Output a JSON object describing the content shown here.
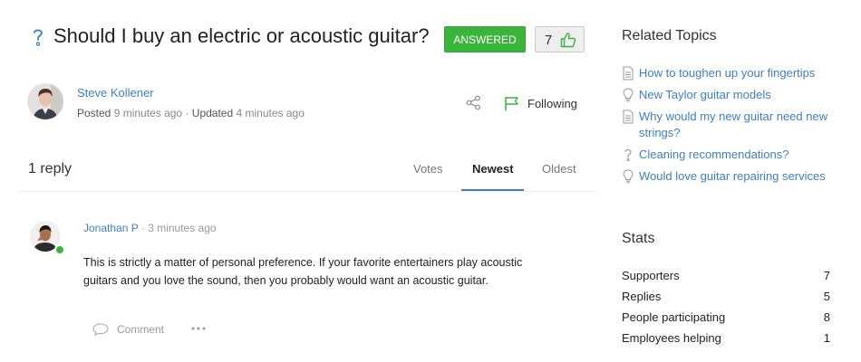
{
  "question": {
    "title": "Should I buy an electric or acoustic guitar?",
    "status_badge": "ANSWERED",
    "vote_count": "7",
    "icons": {
      "type": "question-mark-icon",
      "vote": "thumbs-up-icon"
    },
    "author": {
      "name": "Steve Kollener",
      "posted_label": "Posted",
      "posted_time": "9 minutes ago",
      "separator": "·",
      "updated_label": "Updated",
      "updated_time": "4 minutes ago"
    },
    "actions": {
      "share_icon": "share-icon",
      "follow_label": "Following",
      "follow_icon": "flag-icon"
    }
  },
  "replies": {
    "count_label": "1 reply",
    "sort_tabs": [
      {
        "label": "Votes",
        "active": false
      },
      {
        "label": "Newest",
        "active": true
      },
      {
        "label": "Oldest",
        "active": false
      }
    ],
    "items": [
      {
        "author": "Jonathan P",
        "separator": "·",
        "time": "3 minutes ago",
        "body": "This is strictly a matter of personal preference. If your favorite entertainers play acoustic guitars and you love the sound, then you probably would want an acoustic guitar.",
        "comment_label": "Comment",
        "status": "online",
        "icons": {
          "comment": "speech-bubble-icon",
          "more": "ellipsis-icon"
        }
      }
    ]
  },
  "sidebar": {
    "related_title": "Related Topics",
    "related": [
      {
        "label": "How to toughen up your fingertips",
        "icon": "document-icon"
      },
      {
        "label": "New Taylor guitar models",
        "icon": "lightbulb-icon"
      },
      {
        "label": "Why would my new guitar need new strings?",
        "icon": "document-icon"
      },
      {
        "label": "Cleaning recommendations?",
        "icon": "question-mark-icon"
      },
      {
        "label": "Would love guitar repairing services",
        "icon": "lightbulb-icon"
      }
    ],
    "stats_title": "Stats",
    "stats": [
      {
        "label": "Supporters",
        "value": "7"
      },
      {
        "label": "Replies",
        "value": "5"
      },
      {
        "label": "People participating",
        "value": "8"
      },
      {
        "label": "Employees helping",
        "value": "1"
      }
    ]
  },
  "colors": {
    "accent": "#3f7fbf",
    "answered": "#3bb43b",
    "follow_flag": "#3bb43b",
    "online": "#3bb43b"
  }
}
